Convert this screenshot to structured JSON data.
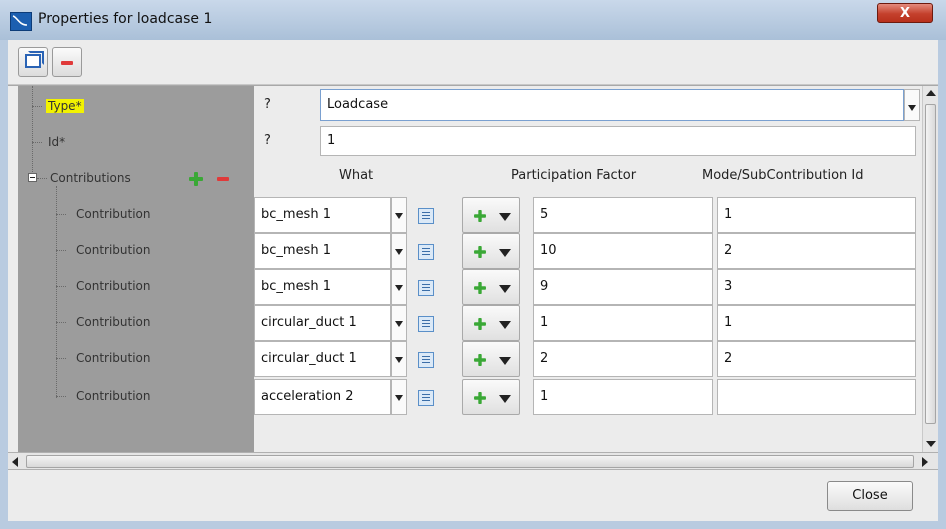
{
  "window": {
    "title": "Properties for loadcase 1",
    "close_glyph": "X"
  },
  "toolbar": {
    "buttons": [
      {
        "icon": "windows-icon"
      },
      {
        "icon": "remove-icon"
      }
    ]
  },
  "tree": {
    "type_label": "Type*",
    "id_label": "Id*",
    "contributions_label": "Contributions",
    "children": [
      "Contribution",
      "Contribution",
      "Contribution",
      "Contribution",
      "Contribution",
      "Contribution"
    ]
  },
  "form": {
    "type_help": "?",
    "type_value": "Loadcase",
    "id_help": "?",
    "id_value": "1"
  },
  "table": {
    "headers": {
      "what": "What",
      "participation": "Participation Factor",
      "mode": "Mode/SubContribution Id"
    },
    "rows": [
      {
        "what": "bc_mesh 1",
        "factor": "5",
        "mode": "1"
      },
      {
        "what": "bc_mesh 1",
        "factor": "10",
        "mode": "2"
      },
      {
        "what": "bc_mesh 1",
        "factor": "9",
        "mode": "3"
      },
      {
        "what": "circular_duct 1",
        "factor": "1",
        "mode": "1"
      },
      {
        "what": "circular_duct 1",
        "factor": "2",
        "mode": "2"
      },
      {
        "what": "acceleration 2",
        "factor": "1",
        "mode": ""
      }
    ]
  },
  "footer": {
    "close_label": "Close"
  },
  "colors": {
    "highlight": "#f2f200",
    "add": "#3aa836",
    "remove": "#e03a3a",
    "title_close": "#c4402c"
  }
}
